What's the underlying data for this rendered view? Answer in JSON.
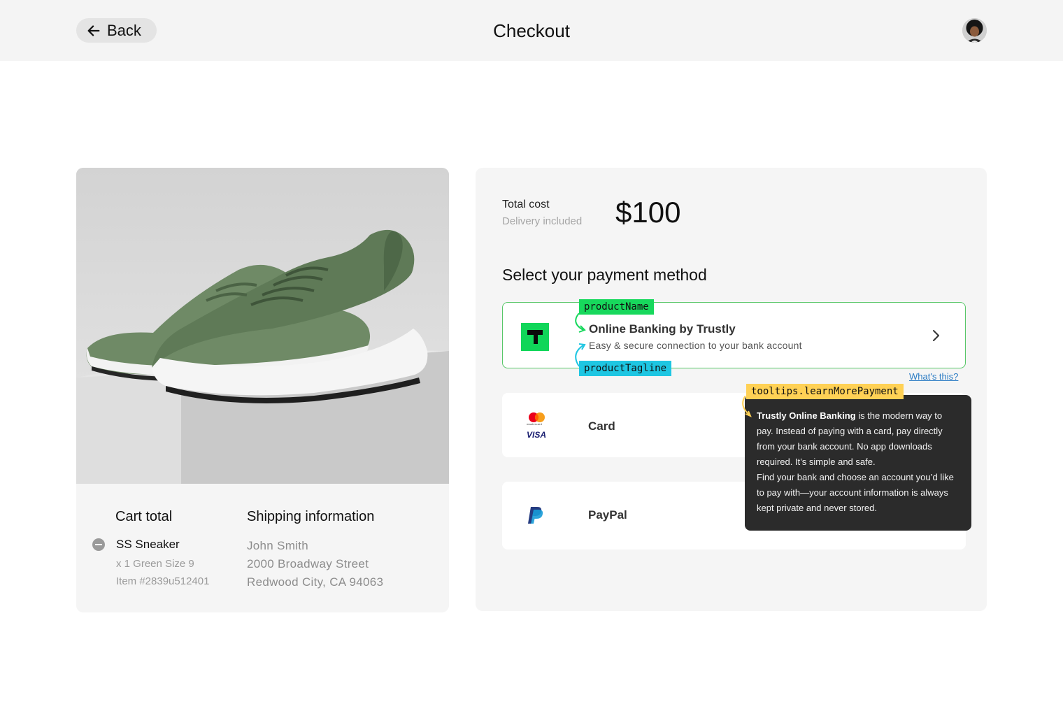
{
  "header": {
    "back_label": "Back",
    "title": "Checkout"
  },
  "cart": {
    "title": "Cart total",
    "item_name": "SS Sneaker",
    "item_variant": "x 1 Green Size 9",
    "item_number": "Item #2839u512401"
  },
  "shipping": {
    "title": "Shipping information",
    "name": "John Smith",
    "street": "2000 Broadway Street",
    "city": "Redwood City, CA 94063"
  },
  "payment": {
    "total_label": "Total cost",
    "total_sub": "Delivery included",
    "total_value": "$100",
    "select_title": "Select your payment method",
    "methods": [
      {
        "name": "Online Banking by Trustly",
        "tagline": "Easy & secure connection to your bank account",
        "icon": "trustly-logo"
      },
      {
        "name": "Card",
        "icon": "mastercard-visa-logo",
        "mastercard_text": "mastercard",
        "visa_text": "VISA"
      },
      {
        "name": "PayPal",
        "icon": "paypal-logo"
      }
    ],
    "whats_this": "What's this?"
  },
  "annotations": {
    "product_name": "productName",
    "product_tagline": "productTagline",
    "tooltip_key": "tooltips.learnMorePayment"
  },
  "tooltip": {
    "bold": "Trustly Online Banking",
    "text1": " is the modern way to pay. Instead of paying with a card, pay directly from your bank account. No app downloads required. It’s simple and safe.",
    "text2": "Find your bank and choose an account you’d like to pay with—your account information is always kept private and never stored."
  },
  "colors": {
    "trustly_green": "#10d659",
    "annotation_green": "#17d85c",
    "annotation_cyan": "#1ec6e2",
    "annotation_yellow": "#ffd155",
    "link_blue": "#2a7bc4"
  }
}
